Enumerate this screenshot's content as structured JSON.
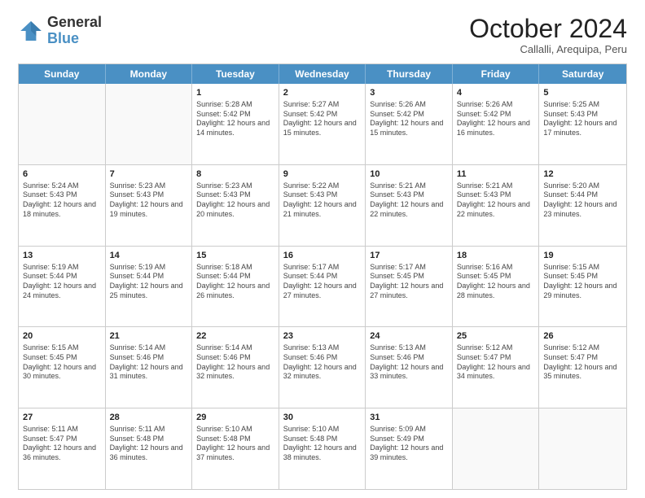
{
  "logo": {
    "general": "General",
    "blue": "Blue"
  },
  "title": "October 2024",
  "location": "Callalli, Arequipa, Peru",
  "days_of_week": [
    "Sunday",
    "Monday",
    "Tuesday",
    "Wednesday",
    "Thursday",
    "Friday",
    "Saturday"
  ],
  "weeks": [
    [
      {
        "day": "",
        "sunrise": "",
        "sunset": "",
        "daylight": "",
        "empty": true
      },
      {
        "day": "",
        "sunrise": "",
        "sunset": "",
        "daylight": "",
        "empty": true
      },
      {
        "day": "1",
        "sunrise": "Sunrise: 5:28 AM",
        "sunset": "Sunset: 5:42 PM",
        "daylight": "Daylight: 12 hours and 14 minutes.",
        "empty": false
      },
      {
        "day": "2",
        "sunrise": "Sunrise: 5:27 AM",
        "sunset": "Sunset: 5:42 PM",
        "daylight": "Daylight: 12 hours and 15 minutes.",
        "empty": false
      },
      {
        "day": "3",
        "sunrise": "Sunrise: 5:26 AM",
        "sunset": "Sunset: 5:42 PM",
        "daylight": "Daylight: 12 hours and 15 minutes.",
        "empty": false
      },
      {
        "day": "4",
        "sunrise": "Sunrise: 5:26 AM",
        "sunset": "Sunset: 5:42 PM",
        "daylight": "Daylight: 12 hours and 16 minutes.",
        "empty": false
      },
      {
        "day": "5",
        "sunrise": "Sunrise: 5:25 AM",
        "sunset": "Sunset: 5:43 PM",
        "daylight": "Daylight: 12 hours and 17 minutes.",
        "empty": false
      }
    ],
    [
      {
        "day": "6",
        "sunrise": "Sunrise: 5:24 AM",
        "sunset": "Sunset: 5:43 PM",
        "daylight": "Daylight: 12 hours and 18 minutes.",
        "empty": false
      },
      {
        "day": "7",
        "sunrise": "Sunrise: 5:23 AM",
        "sunset": "Sunset: 5:43 PM",
        "daylight": "Daylight: 12 hours and 19 minutes.",
        "empty": false
      },
      {
        "day": "8",
        "sunrise": "Sunrise: 5:23 AM",
        "sunset": "Sunset: 5:43 PM",
        "daylight": "Daylight: 12 hours and 20 minutes.",
        "empty": false
      },
      {
        "day": "9",
        "sunrise": "Sunrise: 5:22 AM",
        "sunset": "Sunset: 5:43 PM",
        "daylight": "Daylight: 12 hours and 21 minutes.",
        "empty": false
      },
      {
        "day": "10",
        "sunrise": "Sunrise: 5:21 AM",
        "sunset": "Sunset: 5:43 PM",
        "daylight": "Daylight: 12 hours and 22 minutes.",
        "empty": false
      },
      {
        "day": "11",
        "sunrise": "Sunrise: 5:21 AM",
        "sunset": "Sunset: 5:43 PM",
        "daylight": "Daylight: 12 hours and 22 minutes.",
        "empty": false
      },
      {
        "day": "12",
        "sunrise": "Sunrise: 5:20 AM",
        "sunset": "Sunset: 5:44 PM",
        "daylight": "Daylight: 12 hours and 23 minutes.",
        "empty": false
      }
    ],
    [
      {
        "day": "13",
        "sunrise": "Sunrise: 5:19 AM",
        "sunset": "Sunset: 5:44 PM",
        "daylight": "Daylight: 12 hours and 24 minutes.",
        "empty": false
      },
      {
        "day": "14",
        "sunrise": "Sunrise: 5:19 AM",
        "sunset": "Sunset: 5:44 PM",
        "daylight": "Daylight: 12 hours and 25 minutes.",
        "empty": false
      },
      {
        "day": "15",
        "sunrise": "Sunrise: 5:18 AM",
        "sunset": "Sunset: 5:44 PM",
        "daylight": "Daylight: 12 hours and 26 minutes.",
        "empty": false
      },
      {
        "day": "16",
        "sunrise": "Sunrise: 5:17 AM",
        "sunset": "Sunset: 5:44 PM",
        "daylight": "Daylight: 12 hours and 27 minutes.",
        "empty": false
      },
      {
        "day": "17",
        "sunrise": "Sunrise: 5:17 AM",
        "sunset": "Sunset: 5:45 PM",
        "daylight": "Daylight: 12 hours and 27 minutes.",
        "empty": false
      },
      {
        "day": "18",
        "sunrise": "Sunrise: 5:16 AM",
        "sunset": "Sunset: 5:45 PM",
        "daylight": "Daylight: 12 hours and 28 minutes.",
        "empty": false
      },
      {
        "day": "19",
        "sunrise": "Sunrise: 5:15 AM",
        "sunset": "Sunset: 5:45 PM",
        "daylight": "Daylight: 12 hours and 29 minutes.",
        "empty": false
      }
    ],
    [
      {
        "day": "20",
        "sunrise": "Sunrise: 5:15 AM",
        "sunset": "Sunset: 5:45 PM",
        "daylight": "Daylight: 12 hours and 30 minutes.",
        "empty": false
      },
      {
        "day": "21",
        "sunrise": "Sunrise: 5:14 AM",
        "sunset": "Sunset: 5:46 PM",
        "daylight": "Daylight: 12 hours and 31 minutes.",
        "empty": false
      },
      {
        "day": "22",
        "sunrise": "Sunrise: 5:14 AM",
        "sunset": "Sunset: 5:46 PM",
        "daylight": "Daylight: 12 hours and 32 minutes.",
        "empty": false
      },
      {
        "day": "23",
        "sunrise": "Sunrise: 5:13 AM",
        "sunset": "Sunset: 5:46 PM",
        "daylight": "Daylight: 12 hours and 32 minutes.",
        "empty": false
      },
      {
        "day": "24",
        "sunrise": "Sunrise: 5:13 AM",
        "sunset": "Sunset: 5:46 PM",
        "daylight": "Daylight: 12 hours and 33 minutes.",
        "empty": false
      },
      {
        "day": "25",
        "sunrise": "Sunrise: 5:12 AM",
        "sunset": "Sunset: 5:47 PM",
        "daylight": "Daylight: 12 hours and 34 minutes.",
        "empty": false
      },
      {
        "day": "26",
        "sunrise": "Sunrise: 5:12 AM",
        "sunset": "Sunset: 5:47 PM",
        "daylight": "Daylight: 12 hours and 35 minutes.",
        "empty": false
      }
    ],
    [
      {
        "day": "27",
        "sunrise": "Sunrise: 5:11 AM",
        "sunset": "Sunset: 5:47 PM",
        "daylight": "Daylight: 12 hours and 36 minutes.",
        "empty": false
      },
      {
        "day": "28",
        "sunrise": "Sunrise: 5:11 AM",
        "sunset": "Sunset: 5:48 PM",
        "daylight": "Daylight: 12 hours and 36 minutes.",
        "empty": false
      },
      {
        "day": "29",
        "sunrise": "Sunrise: 5:10 AM",
        "sunset": "Sunset: 5:48 PM",
        "daylight": "Daylight: 12 hours and 37 minutes.",
        "empty": false
      },
      {
        "day": "30",
        "sunrise": "Sunrise: 5:10 AM",
        "sunset": "Sunset: 5:48 PM",
        "daylight": "Daylight: 12 hours and 38 minutes.",
        "empty": false
      },
      {
        "day": "31",
        "sunrise": "Sunrise: 5:09 AM",
        "sunset": "Sunset: 5:49 PM",
        "daylight": "Daylight: 12 hours and 39 minutes.",
        "empty": false
      },
      {
        "day": "",
        "sunrise": "",
        "sunset": "",
        "daylight": "",
        "empty": true
      },
      {
        "day": "",
        "sunrise": "",
        "sunset": "",
        "daylight": "",
        "empty": true
      }
    ]
  ]
}
